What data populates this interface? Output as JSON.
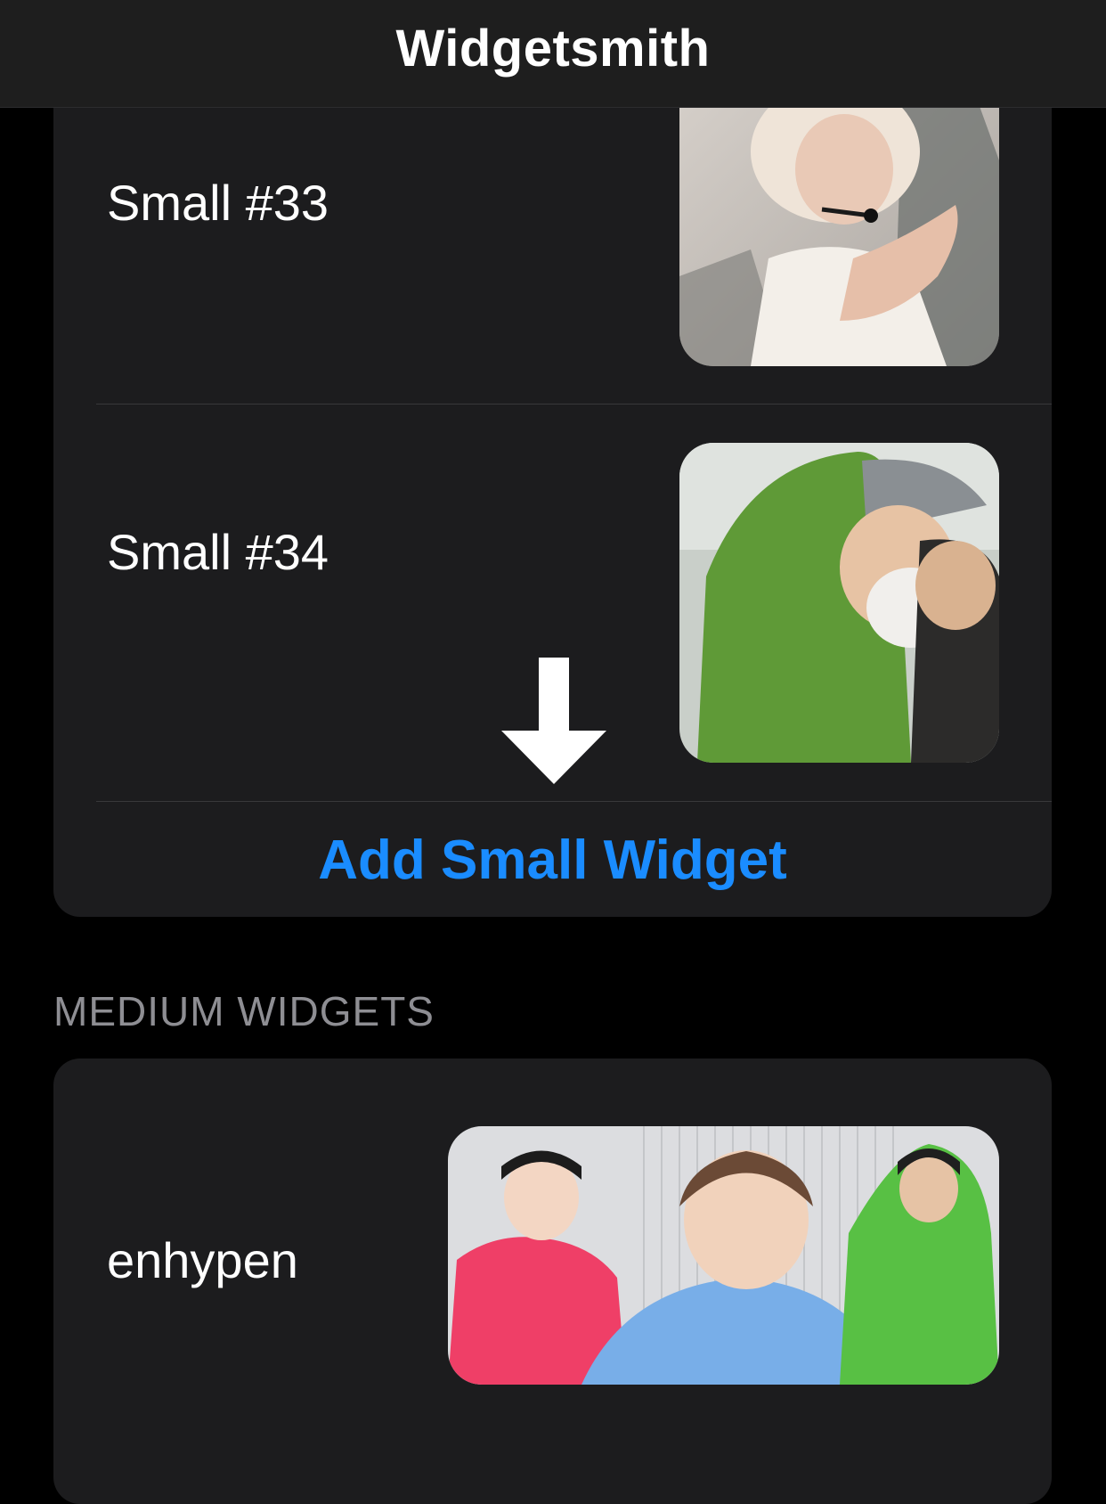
{
  "nav": {
    "title": "Widgetsmith"
  },
  "small_section": {
    "items": [
      {
        "label": "Small #33",
        "thumbnail": "photo-light-haired-performer-with-headset-mic"
      },
      {
        "label": "Small #34",
        "thumbnail": "photo-person-in-green-hoodie-and-mask"
      }
    ],
    "add_label": "Add Small Widget"
  },
  "medium_section": {
    "header": "MEDIUM WIDGETS",
    "items": [
      {
        "label": "enhypen",
        "thumbnail": "photo-three-people-in-pink-blue-green-hoodies"
      }
    ]
  },
  "overlay": {
    "arrow": "down-arrow-icon"
  },
  "colors": {
    "background": "#000000",
    "nav_bar": "#1e1e1e",
    "card": "#1c1c1e",
    "accent": "#1a8cff",
    "secondary_text": "#8e8e93",
    "divider": "#38383a"
  }
}
